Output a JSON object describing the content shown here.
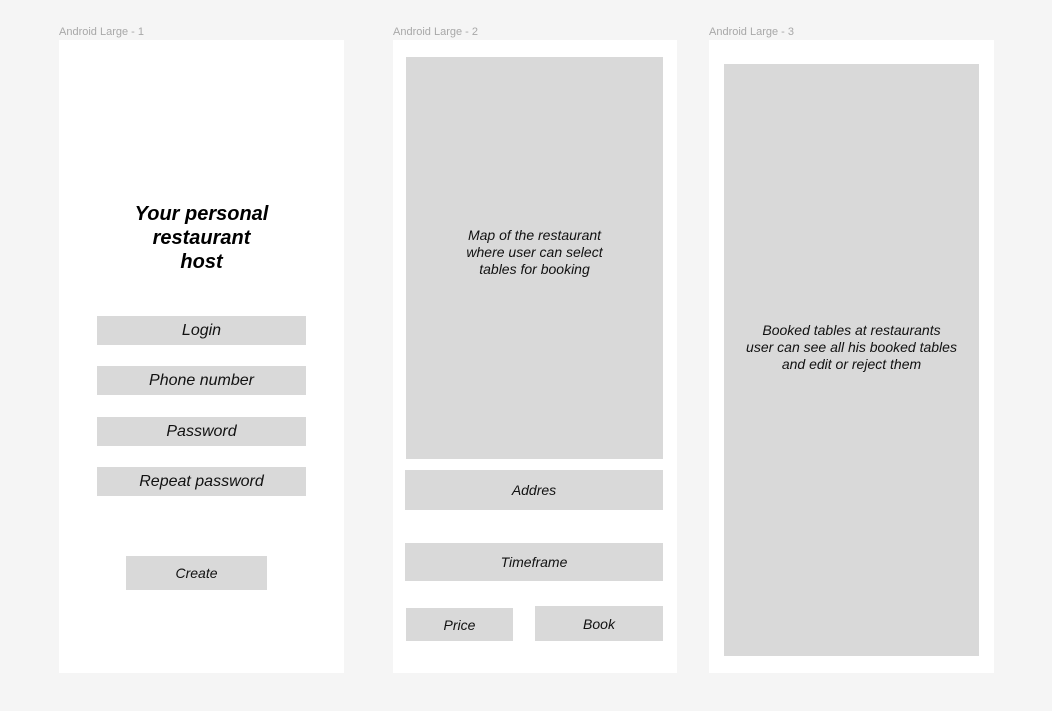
{
  "frames": [
    {
      "label": "Android Large - 1",
      "title": "Your personal\nrestaurant\nhost",
      "fields": [
        "Login",
        "Phone number",
        "Password",
        "Repeat password"
      ],
      "create_label": "Create"
    },
    {
      "label": "Android Large - 2",
      "map_text": "Map of the restaurant\nwhere user can select\ntables for booking",
      "address_label": "Addres",
      "timeframe_label": "Timeframe",
      "price_label": "Price",
      "book_label": "Book"
    },
    {
      "label": "Android Large - 3",
      "booked_text": "Booked tables at restaurants\nuser can see all his booked tables\nand edit or reject them"
    }
  ]
}
